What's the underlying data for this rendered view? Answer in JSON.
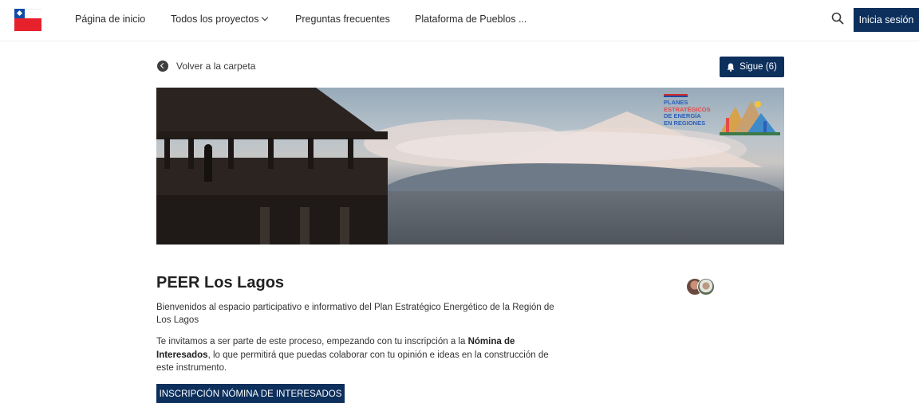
{
  "header": {
    "nav": {
      "home": "Página de inicio",
      "projects": "Todos los proyectos",
      "faq": "Preguntas frecuentes",
      "platform": "Plataforma de Pueblos ..."
    },
    "login_label": "Inicia sesión"
  },
  "subbar": {
    "back_label": "Volver a la carpeta",
    "follow_label": "Sigue (6)"
  },
  "banner": {
    "brand_lines": [
      "PLANES",
      "ESTRATÉGICOS",
      "DE ENERGÍA",
      "EN REGIONES"
    ]
  },
  "content": {
    "title": "PEER Los Lagos",
    "paragraph1": "Bienvenidos al espacio participativo e informativo del Plan Estratégico Energético de la Región de Los Lagos",
    "paragraph2_part1": "Te invitamos a ser parte de este proceso, empezando con tu inscripción a la ",
    "paragraph2_bold": "Nómina de Interesados",
    "paragraph2_part2": ", lo que permitirá que puedas colaborar con tu opinión e ideas en la construcción de este instrumento.",
    "cta_label": "INSCRIPCIÓN NÓMINA DE INTERESADOS"
  },
  "colors": {
    "primary": "#0c2f5c",
    "flag_red": "#e6212c",
    "flag_blue": "#0f4ca8"
  },
  "icons": [
    "chile-logo-icon",
    "chevron-down-icon",
    "search-icon",
    "back-arrow-icon",
    "bell-icon"
  ]
}
